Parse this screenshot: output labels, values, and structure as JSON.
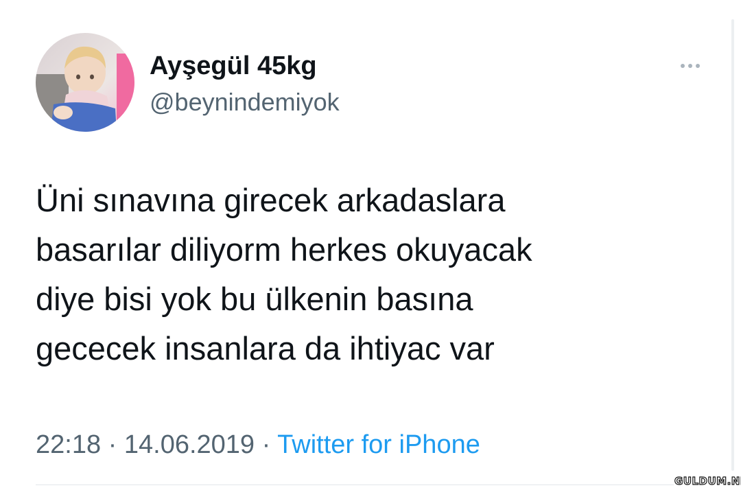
{
  "tweet": {
    "author": {
      "display_name": "Ayşegül 45kg",
      "handle": "@beynindemiyok",
      "avatar_icon": "toddler-photo-avatar"
    },
    "more_icon": "more-horizontal-icon",
    "text_lines": [
      "Üni sınavına girecek arkadaslara",
      "basarılar diliyorm herkes okuyacak",
      "diye bisi yok bu ülkenin basına",
      "gececek insanlara da ihtiyac var"
    ],
    "meta": {
      "time": "22:18",
      "separator": "·",
      "date": "14.06.2019",
      "source": "Twitter for iPhone"
    }
  },
  "watermark": "GULDUM.NET",
  "colors": {
    "text_primary": "#0f1419",
    "text_secondary": "#536471",
    "link_blue": "#1d9bf0",
    "background": "#ffffff"
  }
}
